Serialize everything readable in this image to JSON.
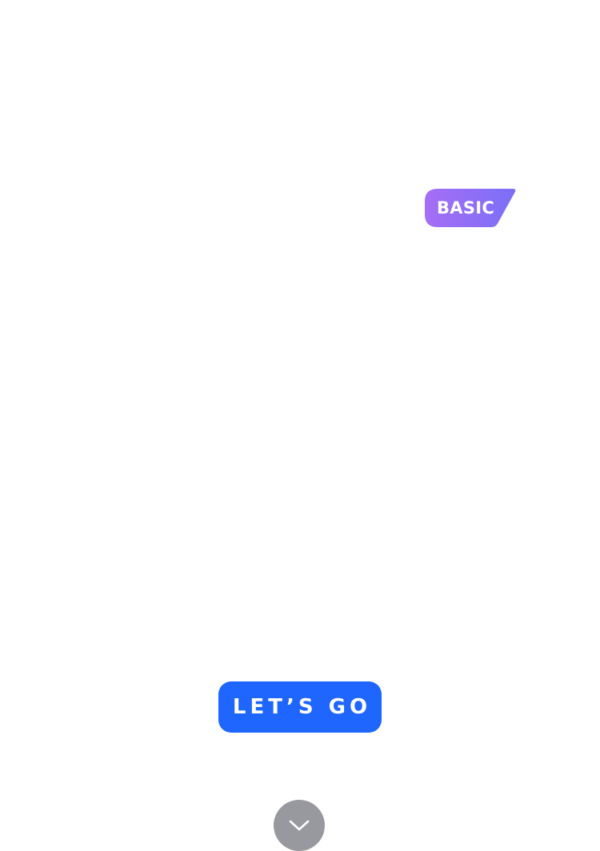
{
  "badge": {
    "label": "BASIC",
    "gradient_start": "#a56ef6",
    "gradient_end": "#7b6ff7"
  },
  "cta": {
    "label": "LET’S GO",
    "background": "#1f66ff",
    "text_color": "#ffffff"
  },
  "scroll_button": {
    "icon": "chevron-down-icon",
    "background": "#98989f",
    "icon_color": "#ffffff"
  }
}
